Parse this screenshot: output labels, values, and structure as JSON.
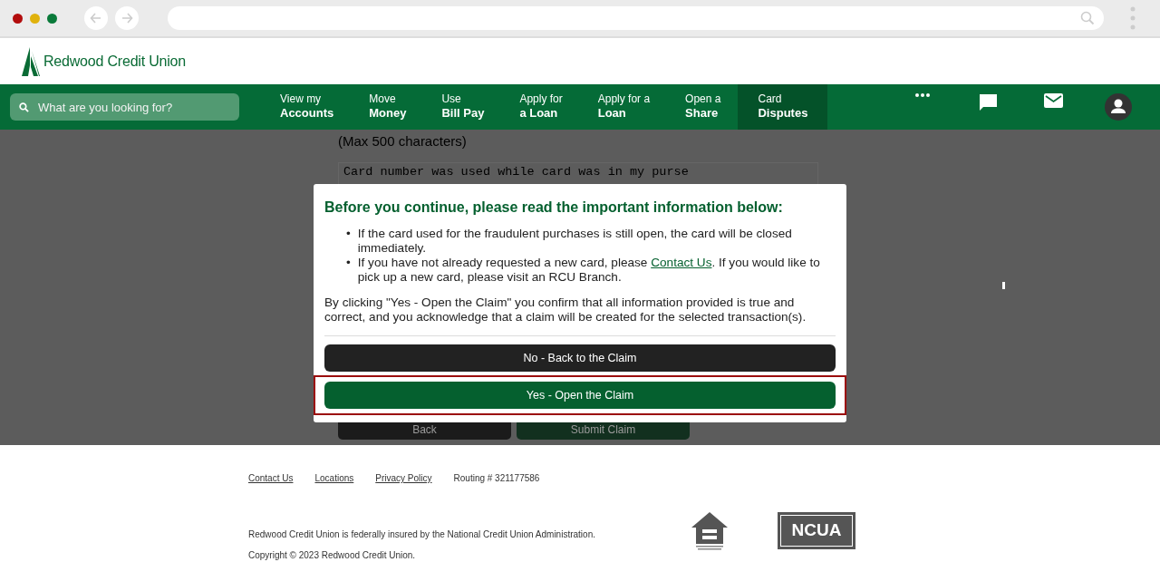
{
  "header": {
    "logo_text": "Redwood Credit Union"
  },
  "nav": {
    "search_placeholder": "What are you looking for?",
    "items": [
      {
        "line1": "View my",
        "line2": "Accounts",
        "selected": false
      },
      {
        "line1": "Move",
        "line2": "Money",
        "selected": false
      },
      {
        "line1": "Use",
        "line2": "Bill Pay",
        "selected": false
      },
      {
        "line1": "Apply for",
        "line2": "a Loan",
        "selected": false
      },
      {
        "line1": "Apply for a",
        "line2": "Loan",
        "selected": false
      },
      {
        "line1": "Open a",
        "line2": "Share",
        "selected": false
      },
      {
        "line1": "Card",
        "line2": "Disputes",
        "selected": true
      }
    ]
  },
  "background_form": {
    "hint": "(Max 500 characters)",
    "textarea_value": "Card number was used while card was in my purse",
    "buttons": [
      {
        "label": "Back",
        "kind": "dark"
      },
      {
        "label": "Submit Claim",
        "kind": "primary"
      }
    ]
  },
  "modal": {
    "title": "Before you continue, please read the important information below:",
    "bullets": [
      {
        "marker": "•",
        "text": "If the card used for the fraudulent purchases is still open, the card will be closed immediately."
      },
      {
        "marker": "•",
        "text": "If you have not already requested a new card, please ",
        "link": "Contact Us",
        "after": ". If you would like to pick up a new card, please visit an RCU Branch."
      }
    ],
    "paragraph": "By clicking \"Yes - Open the Claim\" you confirm that all information provided is true and correct, and you acknowledge that a claim will be created for the selected transaction(s).",
    "buttons": [
      {
        "label": "No - Back to the Claim",
        "kind": "dark",
        "highlighted": false
      },
      {
        "label": "Yes - Open the Claim",
        "kind": "primary",
        "highlighted": true
      }
    ]
  },
  "footer": {
    "links": [
      "Contact Us",
      "Locations",
      "Privacy Policy"
    ],
    "routing": "Routing # 321177586",
    "insured": "Redwood Credit Union is federally insured by the National Credit Union Administration.",
    "copyright": "Copyright © 2023 Redwood Credit Union.",
    "ncua_text": "NCUA"
  }
}
